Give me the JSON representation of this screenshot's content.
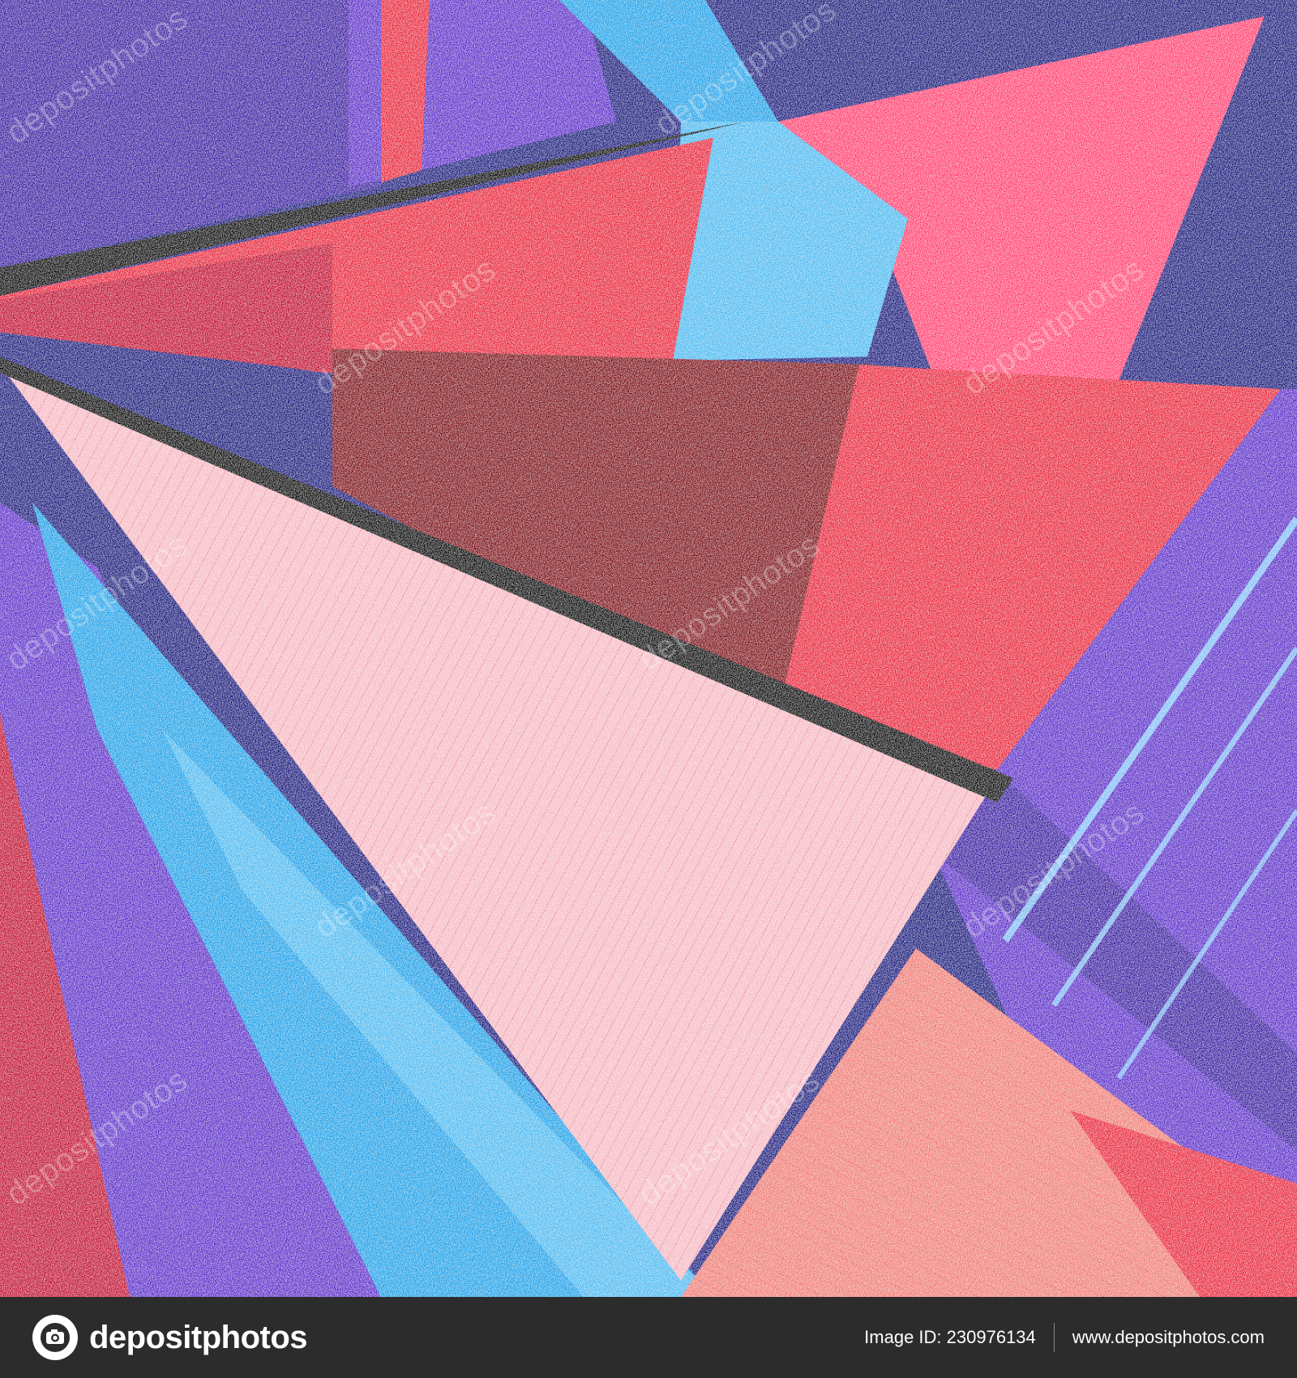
{
  "artwork": {
    "colors": {
      "navy": "#1a1a7a",
      "indigo": "#3a1fa0",
      "violet": "#5a2ec8",
      "red": "#e8253a",
      "crimson": "#c01030",
      "dark_red": "#7a1218",
      "pink": "#ff3f6e",
      "salmon": "#f07a72",
      "blush": "#f6b8c2",
      "cyan": "#1e9fe8",
      "sky": "#4ab8f0",
      "black": "#0a0a0a"
    }
  },
  "watermark": {
    "text": "depositphotos"
  },
  "footer": {
    "brand_name": "depositphotos",
    "brand_icon": "camera-icon",
    "image_id": "Image ID: 230976134",
    "site_url": "www.depositphotos.com"
  }
}
